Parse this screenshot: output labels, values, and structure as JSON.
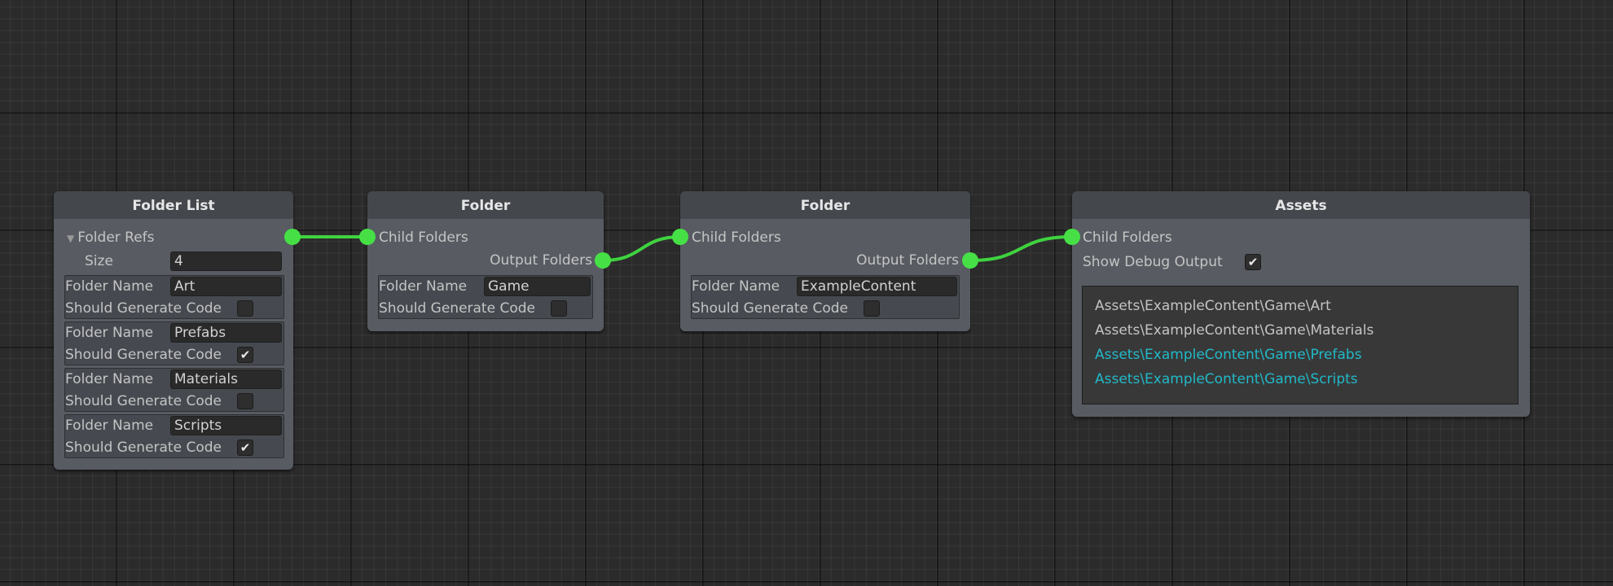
{
  "colors": {
    "wire": "#3fd33f",
    "port": "#46e046",
    "highlight_text": "#21b9c8",
    "text": "#c4c4c4"
  },
  "folder_list": {
    "title": "Folder List",
    "refs_label": "Folder Refs",
    "size_label": "Size",
    "size_value": "4",
    "items": [
      {
        "name_label": "Folder Name",
        "name": "Art",
        "gen_label": "Should Generate Code",
        "checked": false
      },
      {
        "name_label": "Folder Name",
        "name": "Prefabs",
        "gen_label": "Should Generate Code",
        "checked": true
      },
      {
        "name_label": "Folder Name",
        "name": "Materials",
        "gen_label": "Should Generate Code",
        "checked": false
      },
      {
        "name_label": "Folder Name",
        "name": "Scripts",
        "gen_label": "Should Generate Code",
        "checked": true
      }
    ]
  },
  "folder_game": {
    "title": "Folder",
    "child_label": "Child Folders",
    "output_label": "Output Folders",
    "name_label": "Folder Name",
    "name": "Game",
    "gen_label": "Should Generate Code",
    "checked": false
  },
  "folder_example": {
    "title": "Folder",
    "child_label": "Child Folders",
    "output_label": "Output Folders",
    "name_label": "Folder Name",
    "name": "ExampleContent",
    "gen_label": "Should Generate Code",
    "checked": false
  },
  "assets": {
    "title": "Assets",
    "child_label": "Child Folders",
    "debug_label": "Show Debug Output",
    "debug_checked": true,
    "paths": [
      {
        "text": "Assets\\ExampleContent\\Game\\Art",
        "highlight": false
      },
      {
        "text": "Assets\\ExampleContent\\Game\\Materials",
        "highlight": false
      },
      {
        "text": "Assets\\ExampleContent\\Game\\Prefabs",
        "highlight": true
      },
      {
        "text": "Assets\\ExampleContent\\Game\\Scripts",
        "highlight": true
      }
    ]
  }
}
